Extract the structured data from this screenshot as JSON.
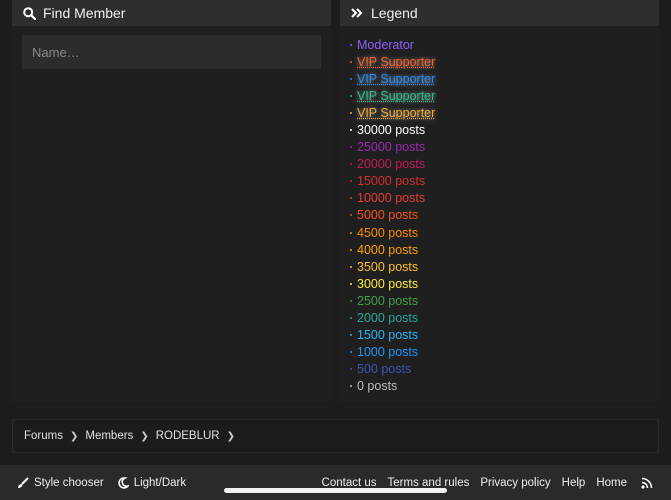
{
  "find_member": {
    "title": "Find Member",
    "placeholder": "Name…"
  },
  "legend": {
    "title": "Legend",
    "items": [
      {
        "label": "Moderator",
        "color": "#8f5cff"
      },
      {
        "label": "VIP Supporter",
        "color": "#ff5a1f"
      },
      {
        "label": "VIP Supporter",
        "color": "#1a8cff"
      },
      {
        "label": "VIP Supporter",
        "color": "#1fbf8f"
      },
      {
        "label": "VIP Supporter",
        "color": "#f5a623"
      },
      {
        "label": "30000 posts",
        "color": "#ffffff"
      },
      {
        "label": "25000 posts",
        "color": "#9c27b0"
      },
      {
        "label": "20000 posts",
        "color": "#c2185b"
      },
      {
        "label": "15000 posts",
        "color": "#d32f2f"
      },
      {
        "label": "10000 posts",
        "color": "#e53935"
      },
      {
        "label": "5000 posts",
        "color": "#f4511e"
      },
      {
        "label": "4500 posts",
        "color": "#fb8c00"
      },
      {
        "label": "4000 posts",
        "color": "#ffa000"
      },
      {
        "label": "3500 posts",
        "color": "#fbc02d"
      },
      {
        "label": "3000 posts",
        "color": "#ffeb3b"
      },
      {
        "label": "2500 posts",
        "color": "#43a047"
      },
      {
        "label": "2000 posts",
        "color": "#26a69a"
      },
      {
        "label": "1500 posts",
        "color": "#29b6f6"
      },
      {
        "label": "1000 posts",
        "color": "#2196f3"
      },
      {
        "label": "500 posts",
        "color": "#3f51b5"
      },
      {
        "label": "0 posts",
        "color": "#bdbdbd"
      }
    ]
  },
  "breadcrumb": [
    "Forums",
    "Members",
    "RODEBLUR"
  ],
  "footer": {
    "style_chooser": "Style chooser",
    "light_dark": "Light/Dark",
    "links": [
      "Contact us",
      "Terms and rules",
      "Privacy policy",
      "Help",
      "Home"
    ]
  },
  "icons": {
    "find": "search-icon",
    "legend": "double-chevron-right-icon",
    "style": "paintbrush-icon",
    "theme": "moon-icon",
    "rss": "rss-icon"
  }
}
